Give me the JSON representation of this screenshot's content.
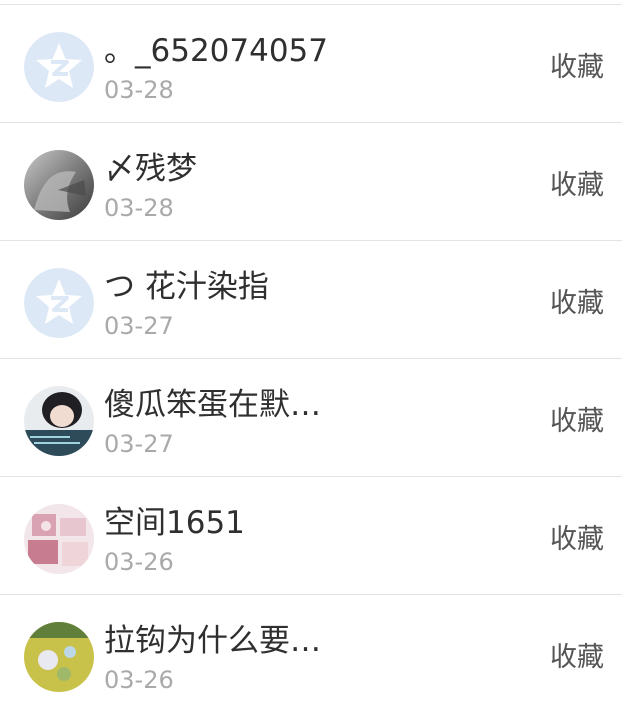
{
  "items": [
    {
      "name": "。_652074057",
      "date": "03-28",
      "action": "收藏",
      "avatar": "qq-default-avatar-icon"
    },
    {
      "name": "〆残梦",
      "date": "03-28",
      "action": "收藏",
      "avatar": "user-photo-avatar"
    },
    {
      "name": "つ 花汁染指",
      "date": "03-27",
      "action": "收藏",
      "avatar": "qq-default-avatar-icon"
    },
    {
      "name": "傻瓜笨蛋在默…",
      "date": "03-27",
      "action": "收藏",
      "avatar": "user-photo-avatar"
    },
    {
      "name": "空间1651",
      "date": "03-26",
      "action": "收藏",
      "avatar": "user-photo-avatar"
    },
    {
      "name": "拉钩为什么要…",
      "date": "03-26",
      "action": "收藏",
      "avatar": "user-photo-avatar"
    }
  ],
  "colors": {
    "name_text": "#2f2f2f",
    "date_text": "#a9a9a9",
    "action_text": "#555555",
    "divider": "#e3e3e3",
    "default_avatar_bg": "#dde8f6"
  }
}
